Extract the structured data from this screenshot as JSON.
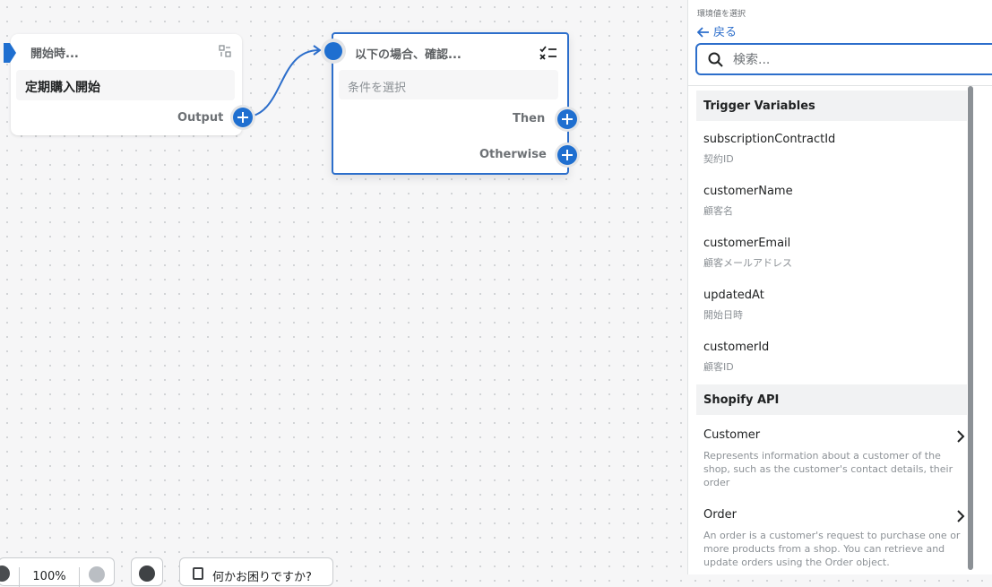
{
  "trigger_node": {
    "title": "開始時...",
    "value": "定期購入開始",
    "output_label": "Output"
  },
  "condition_node": {
    "title": "以下の場合、確認...",
    "placeholder": "条件を選択",
    "then_label": "Then",
    "otherwise_label": "Otherwise"
  },
  "bottom": {
    "zoom": "100%",
    "help_label": "何かお困りですか?"
  },
  "panel": {
    "caption": "環境値を選択",
    "back_label": "戻る",
    "search_placeholder": "検索...",
    "sections": [
      {
        "title": "Trigger Variables",
        "items": [
          {
            "name": "subscriptionContractId",
            "sub": "契約ID"
          },
          {
            "name": "customerName",
            "sub": "顧客名"
          },
          {
            "name": "customerEmail",
            "sub": "顧客メールアドレス"
          },
          {
            "name": "updatedAt",
            "sub": "開始日時"
          },
          {
            "name": "customerId",
            "sub": "顧客ID"
          }
        ]
      },
      {
        "title": "Shopify API",
        "items": [
          {
            "name": "Customer",
            "sub": "Represents information about a customer of the shop, such as the customer's contact details, their order"
          },
          {
            "name": "Order",
            "sub": "An order is a customer's request to purchase one or more products from a shop. You can retrieve and update orders using the Order object."
          }
        ]
      }
    ]
  },
  "colors": {
    "accent": "#2c6ecb",
    "port": "#1f6fd0"
  }
}
